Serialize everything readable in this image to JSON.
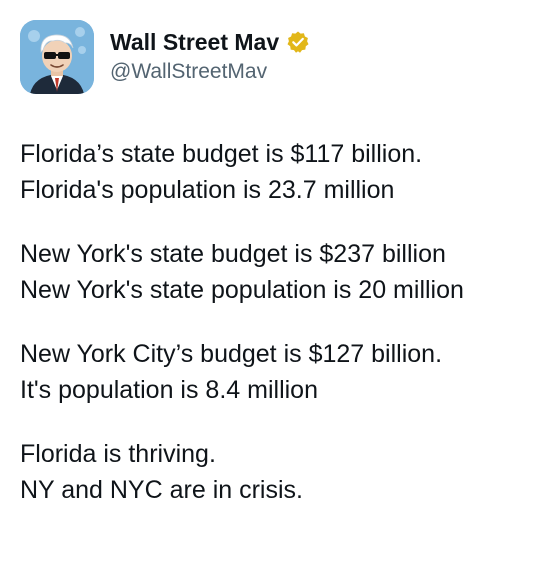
{
  "author": {
    "display_name": "Wall Street Mav",
    "handle": "@WallStreetMav",
    "avatar_icon": "cartoon-businessman-sunglasses-icon",
    "verified_icon": "gold-verified-badge-icon",
    "verified_color": "#e2b719"
  },
  "tweet": {
    "paragraphs": [
      {
        "lines": [
          "Florida’s state budget is $117 billion.",
          "Florida's population is 23.7 million"
        ]
      },
      {
        "lines": [
          "New York's state budget is $237 billion",
          "New York's state population is 20 million"
        ]
      },
      {
        "lines": [
          "New York City’s budget is $127 billion.",
          "It's population is 8.4 million"
        ]
      },
      {
        "lines": [
          "Florida is thriving.",
          "NY and NYC are in crisis."
        ]
      }
    ]
  }
}
